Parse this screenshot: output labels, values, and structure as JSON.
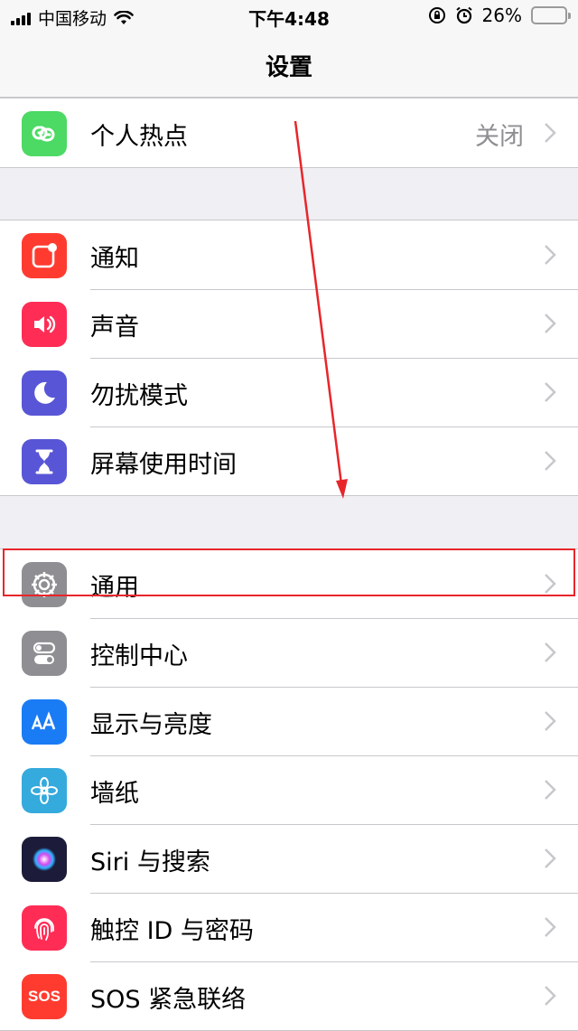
{
  "status_bar": {
    "carrier": "中国移动",
    "time": "下午4:48",
    "battery": "26%",
    "battery_level": 0.26,
    "battery_color": "#f5c518"
  },
  "nav": {
    "title": "设置"
  },
  "groups": [
    {
      "items": [
        {
          "label": "个人热点",
          "value": "关闭",
          "icon": "hotspot-icon",
          "color": "#4cd964"
        }
      ]
    },
    {
      "items": [
        {
          "label": "通知",
          "icon": "notification-icon",
          "color": "#ff3b30"
        },
        {
          "label": "声音",
          "icon": "speaker-icon",
          "color": "#ff2d55"
        },
        {
          "label": "勿扰模式",
          "icon": "moon-icon",
          "color": "#5856d6"
        },
        {
          "label": "屏幕使用时间",
          "icon": "hourglass-icon",
          "color": "#5856d6"
        }
      ]
    },
    {
      "items": [
        {
          "label": "通用",
          "icon": "gear-icon",
          "color": "#8e8e93"
        },
        {
          "label": "控制中心",
          "icon": "toggles-icon",
          "color": "#8e8e93"
        },
        {
          "label": "显示与亮度",
          "icon": "text-size-icon",
          "color": "#1a7cf5"
        },
        {
          "label": "墙纸",
          "icon": "flower-icon",
          "color": "#35aadc"
        },
        {
          "label": "Siri 与搜索",
          "icon": "siri-icon",
          "color": "#1c1c3a"
        },
        {
          "label": "触控 ID 与密码",
          "icon": "fingerprint-icon",
          "color": "#ff2d55"
        },
        {
          "label": "SOS 紧急联络",
          "icon": "sos-icon",
          "color": "#ff3b30",
          "icon_text": "SOS"
        }
      ]
    }
  ],
  "annotation": {
    "highlight_color": "#e8262a"
  }
}
